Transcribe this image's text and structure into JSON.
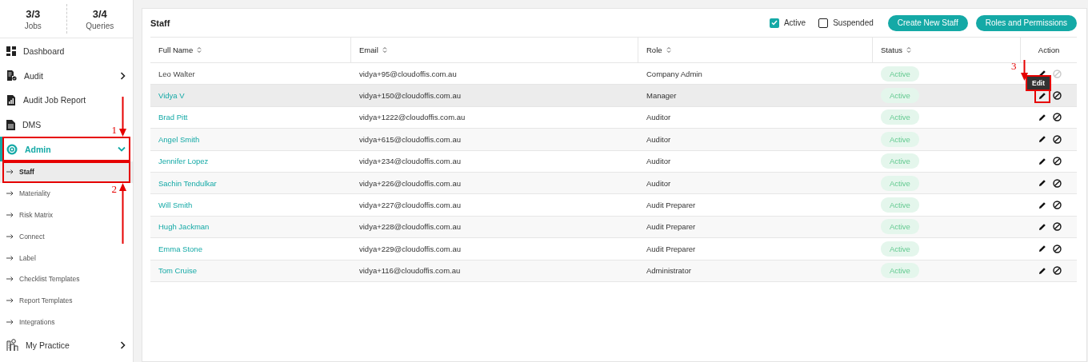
{
  "sidebar": {
    "stats": [
      {
        "value": "3/3",
        "label": "Jobs"
      },
      {
        "value": "3/4",
        "label": "Queries"
      }
    ],
    "nav": [
      {
        "label": "Dashboard",
        "selected": false
      },
      {
        "label": "Audit",
        "selected": false,
        "expanded": false
      },
      {
        "label": "Audit Job Report",
        "selected": false
      },
      {
        "label": "DMS",
        "selected": false
      },
      {
        "label": "Admin",
        "selected": true,
        "expanded": true,
        "callout": "1",
        "children": [
          {
            "label": "Staff",
            "selected": true,
            "callout": "2"
          },
          {
            "label": "Materiality",
            "selected": false
          },
          {
            "label": "Risk Matrix",
            "selected": false
          },
          {
            "label": "Connect",
            "selected": false
          },
          {
            "label": "Label",
            "selected": false
          },
          {
            "label": "Checklist Templates",
            "selected": false
          },
          {
            "label": "Report Templates",
            "selected": false
          },
          {
            "label": "Integrations",
            "selected": false
          }
        ]
      },
      {
        "label": "My Practice",
        "selected": false,
        "expanded": false
      }
    ]
  },
  "card": {
    "title": "Staff",
    "filters": [
      {
        "label": "Active",
        "checked": true
      },
      {
        "label": "Suspended",
        "checked": false
      }
    ],
    "buttons": [
      "Create New Staff",
      "Roles and Permissions"
    ]
  },
  "table": {
    "columns": [
      {
        "label": "Full Name",
        "sortable": true
      },
      {
        "label": "Email",
        "sortable": true
      },
      {
        "label": "Role",
        "sortable": true
      },
      {
        "label": "Status",
        "sortable": true
      },
      {
        "label": "Action",
        "sortable": false
      }
    ],
    "rows": [
      {
        "full_name": "Leo Walter",
        "link": false,
        "hovered": false,
        "email": "vidya+95@cloudoffis.com.au",
        "role": "Company Admin",
        "status": "Active",
        "block_disabled": true
      },
      {
        "full_name": "Vidya V",
        "link": true,
        "hovered": true,
        "email": "vidya+150@cloudoffis.com.au",
        "role": "Manager",
        "status": "Active",
        "block_disabled": false,
        "tooltip": "Edit",
        "callout": "3"
      },
      {
        "full_name": "Brad Pitt",
        "link": true,
        "hovered": false,
        "email": "vidya+1222@cloudoffis.com.au",
        "role": "Auditor",
        "status": "Active",
        "block_disabled": false
      },
      {
        "full_name": "Angel Smith",
        "link": true,
        "hovered": false,
        "email": "vidya+615@cloudoffis.com.au",
        "role": "Auditor",
        "status": "Active",
        "block_disabled": false
      },
      {
        "full_name": "Jennifer Lopez",
        "link": true,
        "hovered": false,
        "email": "vidya+234@cloudoffis.com.au",
        "role": "Auditor",
        "status": "Active",
        "block_disabled": false
      },
      {
        "full_name": "Sachin Tendulkar",
        "link": true,
        "hovered": false,
        "email": "vidya+226@cloudoffis.com.au",
        "role": "Auditor",
        "status": "Active",
        "block_disabled": false
      },
      {
        "full_name": "Will Smith",
        "link": true,
        "hovered": false,
        "email": "vidya+227@cloudoffis.com.au",
        "role": "Audit Preparer",
        "status": "Active",
        "block_disabled": false
      },
      {
        "full_name": "Hugh Jackman",
        "link": true,
        "hovered": false,
        "email": "vidya+228@cloudoffis.com.au",
        "role": "Audit Preparer",
        "status": "Active",
        "block_disabled": false
      },
      {
        "full_name": "Emma Stone",
        "link": true,
        "hovered": false,
        "email": "vidya+229@cloudoffis.com.au",
        "role": "Audit Preparer",
        "status": "Active",
        "block_disabled": false
      },
      {
        "full_name": "Tom Cruise",
        "link": true,
        "hovered": false,
        "email": "vidya+116@cloudoffis.com.au",
        "role": "Administrator",
        "status": "Active",
        "block_disabled": false
      }
    ]
  }
}
